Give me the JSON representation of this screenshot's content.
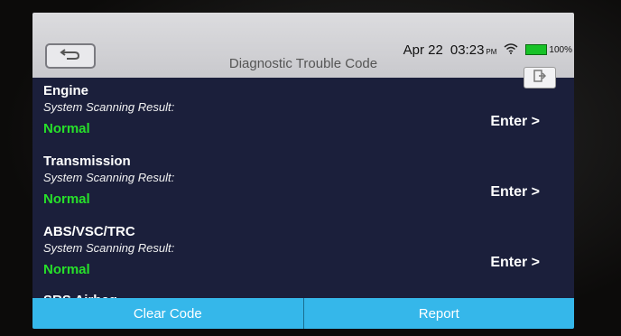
{
  "status_bar": {
    "date": "Apr 22",
    "time": "03:23",
    "ampm": "PM",
    "battery": "100%"
  },
  "header": {
    "title": "Diagnostic Trouble Code"
  },
  "systems": [
    {
      "name": "Engine",
      "sub": "System Scanning Result:",
      "result": "Normal",
      "action": "Enter >"
    },
    {
      "name": "Transmission",
      "sub": "System Scanning Result:",
      "result": "Normal",
      "action": "Enter >"
    },
    {
      "name": "ABS/VSC/TRC",
      "sub": "System Scanning Result:",
      "result": "Normal",
      "action": "Enter >"
    }
  ],
  "partial_item": "SRS Airbag",
  "footer": {
    "clear_label": "Clear Code",
    "report_label": "Report"
  },
  "colors": {
    "screen_bg": "#1b1f3b",
    "normal": "#27e02a",
    "button": "#35b7ea"
  }
}
